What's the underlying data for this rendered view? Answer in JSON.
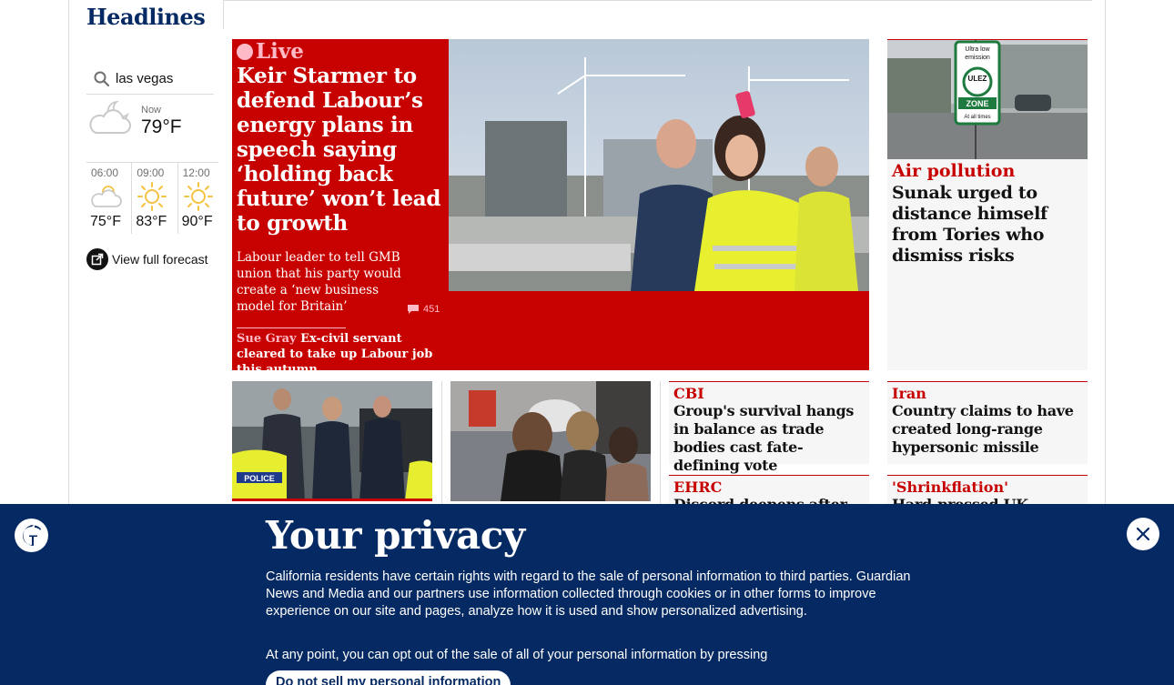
{
  "page": {
    "section_title": "Headlines"
  },
  "weather": {
    "search_value": "las vegas",
    "now_label": "Now",
    "now_temp": "79°F",
    "forecast": [
      {
        "time": "06:00",
        "temp": "75°F",
        "icon": "partly-sunny-icon"
      },
      {
        "time": "09:00",
        "temp": "83°F",
        "icon": "sun-icon"
      },
      {
        "time": "12:00",
        "temp": "90°F",
        "icon": "sun-icon"
      }
    ],
    "view_full_label": "View full forecast"
  },
  "feature": {
    "live_label": "Live",
    "headline": "Keir Starmer to defend Labour’s energy plans in speech saying ‘holding back future’ won’t lead to growth",
    "standfirst": "Labour leader to tell GMB union that his party would create a ‘new business model for Britain’",
    "comment_count": "451",
    "sublink_kicker": "Sue Gray",
    "sublink_text": "Ex-civil servant cleared to take up Labour job this autumn",
    "colors": {
      "background": "#c70000",
      "kicker": "#ffbac8"
    }
  },
  "right_top": {
    "kicker": "Air pollution",
    "headline": "Sunak urged to distance himself from Tories who dismiss risks",
    "sign_text": {
      "line1": "Ultra low",
      "line2": "emission",
      "ulez": "ULEZ",
      "zone": "ZONE",
      "times": "At all times"
    }
  },
  "small_cards": [
    {
      "kicker": "CBI",
      "headline": "Group's survival hangs in balance as trade bodies cast fate-defining vote"
    },
    {
      "kicker": "Iran",
      "headline": "Country claims to have created long-range hypersonic missile"
    },
    {
      "kicker": "EHRC",
      "headline": "Discord deepens after"
    },
    {
      "kicker": "'Shrinkflation'",
      "headline": "Hard-pressed UK shoppers"
    }
  ],
  "photo_cards": [
    {
      "police_text": "POLICE"
    }
  ],
  "privacy": {
    "title": "Your privacy",
    "body": "California residents have certain rights with regard to the sale of personal information to third parties. Guardian News and Media and our partners use information collected through cookies or in other forms to improve experience on our site and pages, analyze how it is used and show personalized advertising.",
    "body2": "At any point, you can opt out of the sale of all of your personal information by pressing",
    "button_label": "Do not sell my personal information",
    "colors": {
      "background": "#052962"
    }
  }
}
